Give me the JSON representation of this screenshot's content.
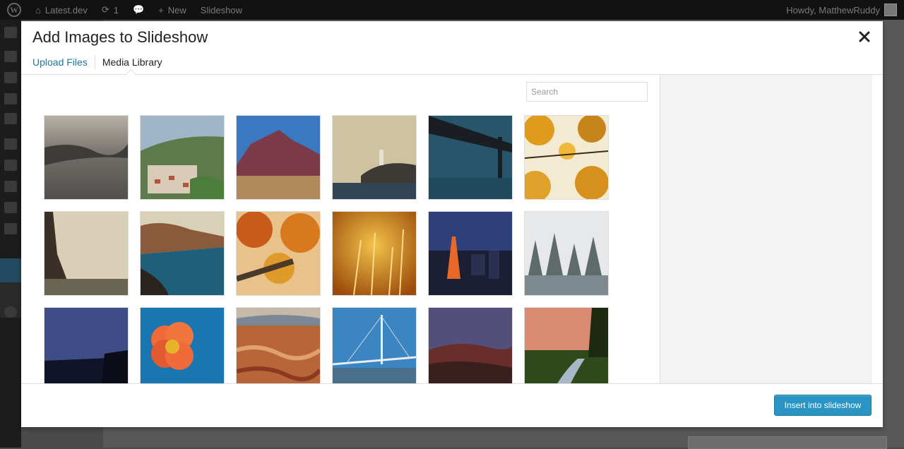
{
  "admin_bar": {
    "site_name": "Latest.dev",
    "updates_count": "1",
    "new_label": "New",
    "current_page": "Slideshow",
    "greeting": "Howdy, MatthewRuddy"
  },
  "modal": {
    "title": "Add Images to Slideshow",
    "tabs": [
      {
        "label": "Upload Files",
        "active": false
      },
      {
        "label": "Media Library",
        "active": true
      }
    ],
    "search_placeholder": "Search",
    "insert_label": "Insert into slideshow"
  },
  "images": [
    {
      "desc": "misty river"
    },
    {
      "desc": "hillside town"
    },
    {
      "desc": "red mountain"
    },
    {
      "desc": "lighthouse on rocks"
    },
    {
      "desc": "suspension bridge"
    },
    {
      "desc": "autumn leaves"
    },
    {
      "desc": "eiffel tower"
    },
    {
      "desc": "coastal cliff village"
    },
    {
      "desc": "autumn tree canopy"
    },
    {
      "desc": "golden grass"
    },
    {
      "desc": "tokyo tower"
    },
    {
      "desc": "snowy forest"
    },
    {
      "desc": "night coast"
    },
    {
      "desc": "orange flower"
    },
    {
      "desc": "canyon hoodoos"
    },
    {
      "desc": "cable-stayed viaduct"
    },
    {
      "desc": "red hills at dusk"
    },
    {
      "desc": "river sunset"
    }
  ]
}
